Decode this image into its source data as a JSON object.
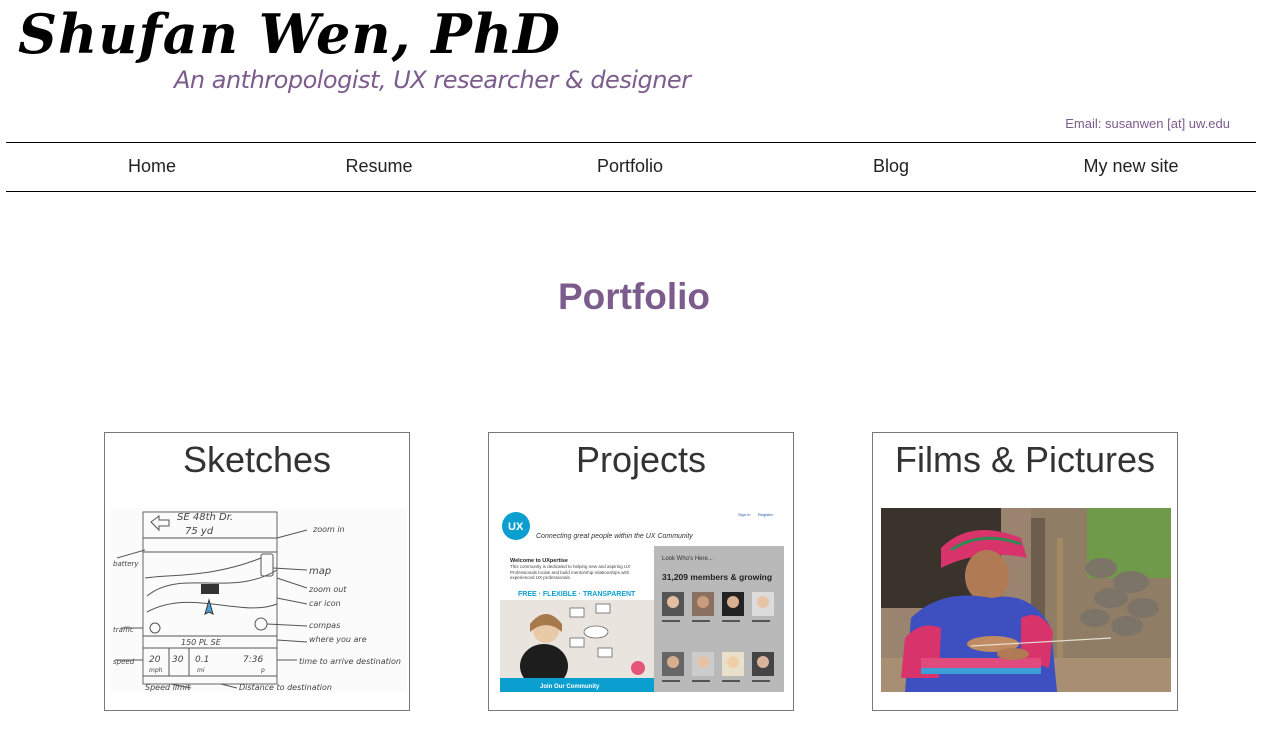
{
  "header": {
    "title": "Shufan Wen, PhD",
    "tagline": "An anthropologist, UX researcher & designer",
    "email": "Email: susanwen [at] uw.edu"
  },
  "nav": {
    "items": [
      {
        "label": "Home"
      },
      {
        "label": "Resume"
      },
      {
        "label": "Portfolio"
      },
      {
        "label": "Blog"
      },
      {
        "label": "My new site"
      }
    ]
  },
  "main": {
    "heading": "Portfolio",
    "cards": [
      {
        "title": "Sketches",
        "sketch_labels": {
          "street": "SE 48th Dr.",
          "distance": "75 yd",
          "zoom_in": "zoom in",
          "map": "map",
          "zoom_out": "zoom out",
          "car_icon": "car icon",
          "compass": "compas",
          "where": "where you are",
          "battery": "battery",
          "traffic": "traffic",
          "speed_now": "20",
          "speed_limit_value": "30",
          "speed_unit": "mph",
          "miles": "0.1",
          "miles_unit": "mi",
          "clock": "7:36",
          "clock_unit": "p",
          "time_note": "time to arrive destination",
          "bottom_left": "Speed limit",
          "bottom_right": "Distance to destination",
          "speed": "speed",
          "address": "150 PL SE"
        }
      },
      {
        "title": "Projects",
        "screenshot": {
          "sign_in": "Sign In",
          "register": "Register",
          "logo": "UX",
          "tagline": "Connecting great people within the UX Community",
          "welcome": "Welcome to UXpertise",
          "intro": "This community is dedicated to helping new and aspiring UX Professionals locate and build mentorship relationships with experienced UX professionals.",
          "slogan": "FREE · FLEXIBLE · TRANSPARENT",
          "join_button": "Join Our Community",
          "look_heading": "Look Who's Here...",
          "members": "31,209 members & growing"
        }
      },
      {
        "title": "Films & Pictures"
      }
    ]
  },
  "colors": {
    "accent": "#7c5c8c",
    "text": "#333333",
    "rule": "#000000",
    "card_border": "#777777",
    "ux_teal": "#0b9fd0"
  }
}
